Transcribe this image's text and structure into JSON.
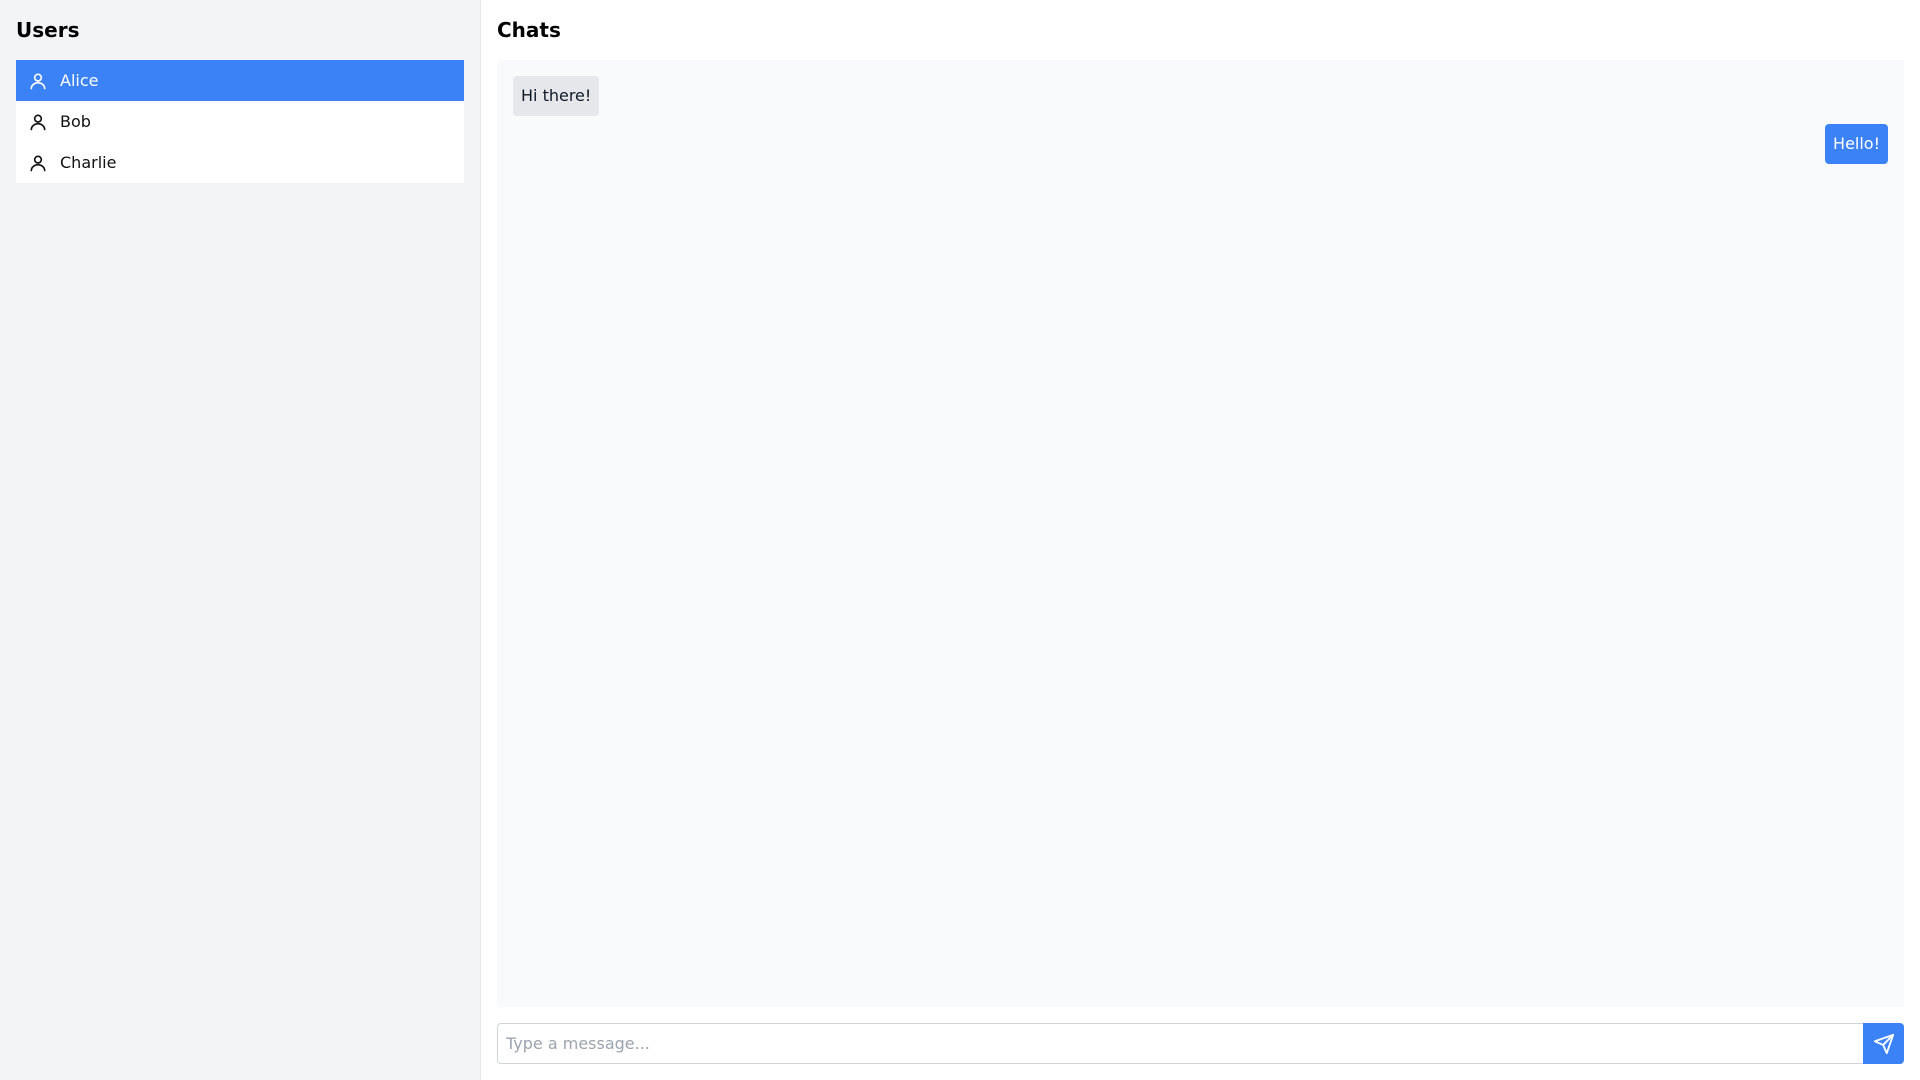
{
  "sidebar": {
    "title": "Users",
    "users": [
      {
        "name": "Alice",
        "active": true,
        "icon": "user-icon"
      },
      {
        "name": "Bob",
        "active": false,
        "icon": "user-icon"
      },
      {
        "name": "Charlie",
        "active": false,
        "icon": "user-icon"
      }
    ]
  },
  "chat": {
    "title": "Chats",
    "messages": [
      {
        "text": "Hi there!",
        "direction": "incoming"
      },
      {
        "text": "Hello!",
        "direction": "outgoing"
      }
    ],
    "input": {
      "value": "",
      "placeholder": "Type a message..."
    },
    "send_icon": "send-icon"
  },
  "colors": {
    "accent": "#3b82f6",
    "sidebar_bg": "#f3f4f6",
    "chat_bg": "#f9fafb",
    "incoming_bubble": "#e5e7eb"
  }
}
